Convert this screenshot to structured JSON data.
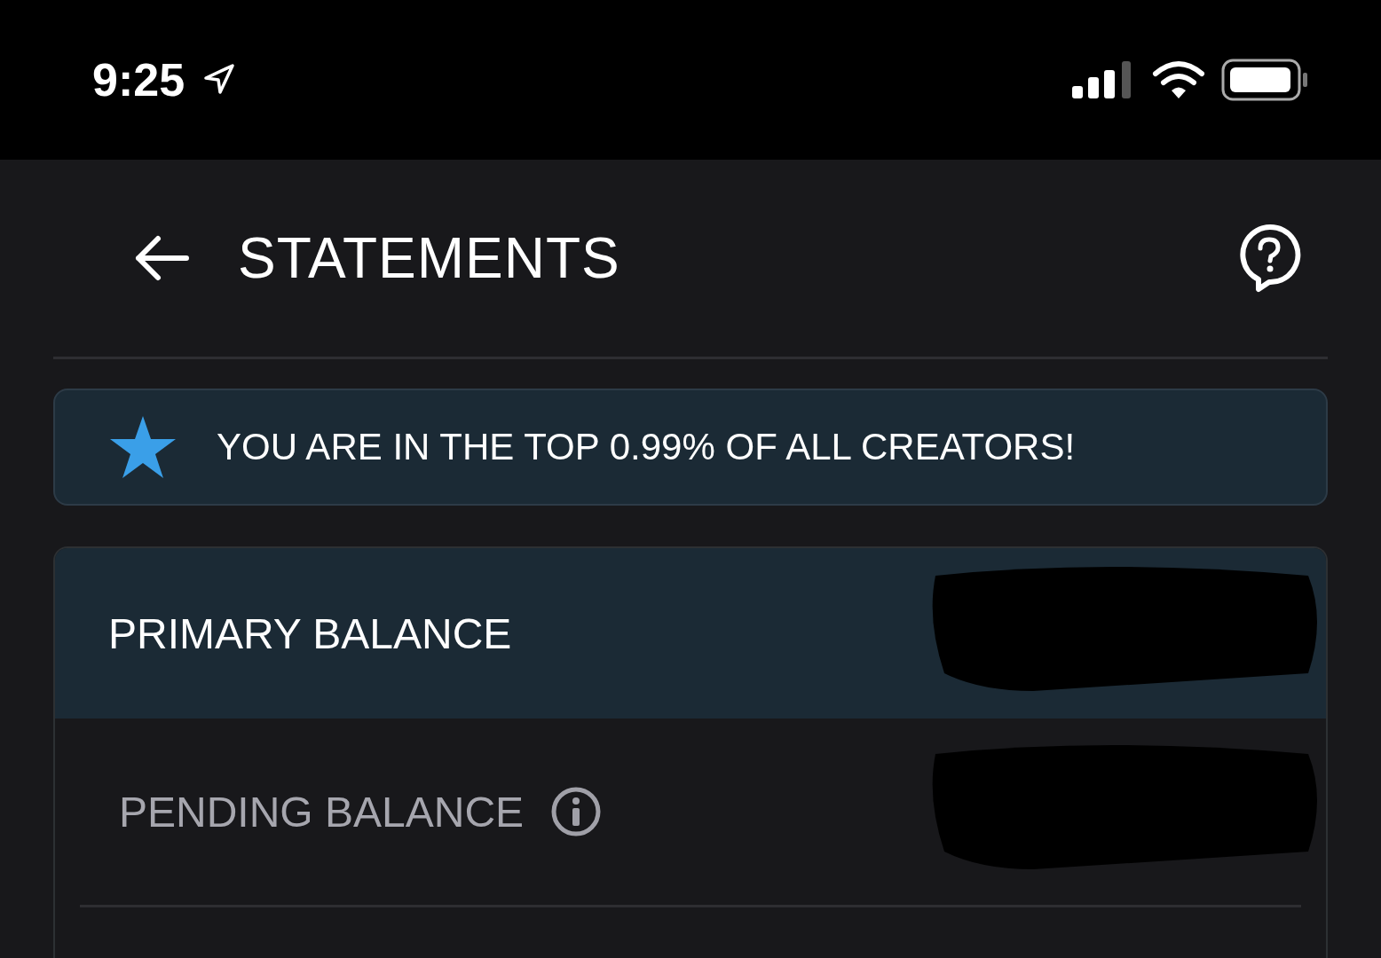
{
  "status_bar": {
    "time": "9:25"
  },
  "header": {
    "title": "STATEMENTS"
  },
  "banner": {
    "text": "YOU ARE IN THE TOP 0.99% OF ALL CREATORS!"
  },
  "balances": [
    {
      "label": "PRIMARY BALANCE",
      "kind": "primary",
      "info": false
    },
    {
      "label": "PENDING BALANCE",
      "kind": "pending",
      "info": true
    }
  ]
}
